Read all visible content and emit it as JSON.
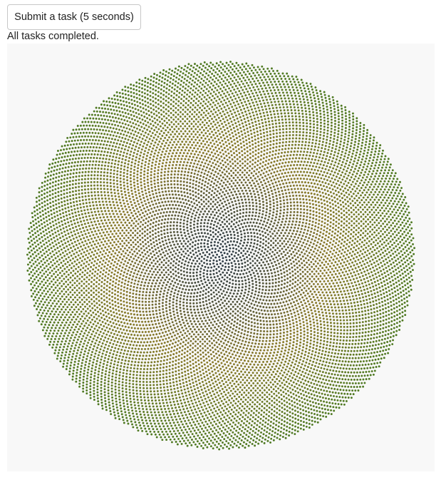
{
  "controls": {
    "submit_button_label": "Submit a task (5 seconds)"
  },
  "status": {
    "message": "All tasks completed."
  },
  "visualization": {
    "description_kind": "phyllotaxis",
    "point_count": 11000,
    "divergence_angle_deg": 137.508,
    "colors": {
      "center": "#2f3d4a",
      "middle": "#8a7a2a",
      "outer": "#4f7a23",
      "background": "#f8f8f8"
    }
  }
}
